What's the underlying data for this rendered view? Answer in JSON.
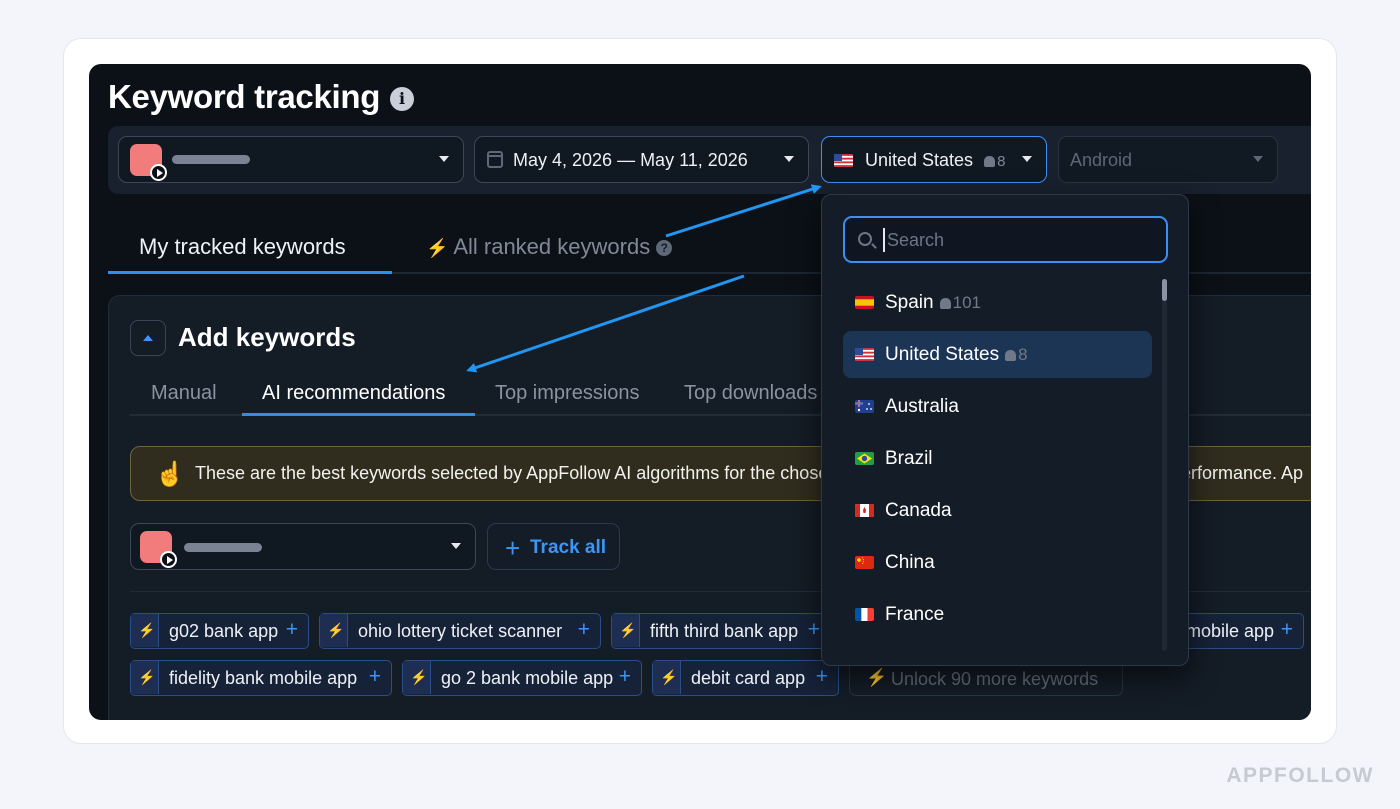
{
  "page": {
    "title": "Keyword tracking",
    "brand": "APPFOLLOW"
  },
  "filters": {
    "date_range": "May 4, 2026 — May 11, 2026",
    "country": "United States",
    "country_count": "8",
    "platform_placeholder": "Android"
  },
  "tabs": [
    {
      "label": "My tracked keywords",
      "active": true
    },
    {
      "label": "All ranked keywords",
      "active": false
    }
  ],
  "panel": {
    "title": "Add keywords",
    "subtabs": [
      {
        "label": "Manual"
      },
      {
        "label": "AI recommendations",
        "active": true
      },
      {
        "label": "Top impressions"
      },
      {
        "label": "Top downloads"
      }
    ],
    "banner_text": "These are the best keywords selected by AppFollow AI algorithms for the chose",
    "banner_text_end": "erformance. Ap",
    "track_all_label": "Track all",
    "keywords": [
      "g02 bank app",
      "ohio lottery ticket scanner",
      "fifth third bank app",
      "mobile app",
      "fidelity bank mobile app",
      "go 2 bank mobile app",
      "debit card app"
    ],
    "unlock_label": "Unlock 90 more keywords"
  },
  "country_menu": {
    "search_placeholder": "Search",
    "options": [
      {
        "name": "Spain",
        "count": "101"
      },
      {
        "name": "United States",
        "count": "8",
        "selected": true
      },
      {
        "name": "Australia"
      },
      {
        "name": "Brazil"
      },
      {
        "name": "Canada"
      },
      {
        "name": "China"
      },
      {
        "name": "France"
      }
    ]
  },
  "colors": {
    "accent": "#2e8df0",
    "background": "#0c1117",
    "chip_border": "#2a4f86",
    "banner_border": "#6f6539"
  }
}
